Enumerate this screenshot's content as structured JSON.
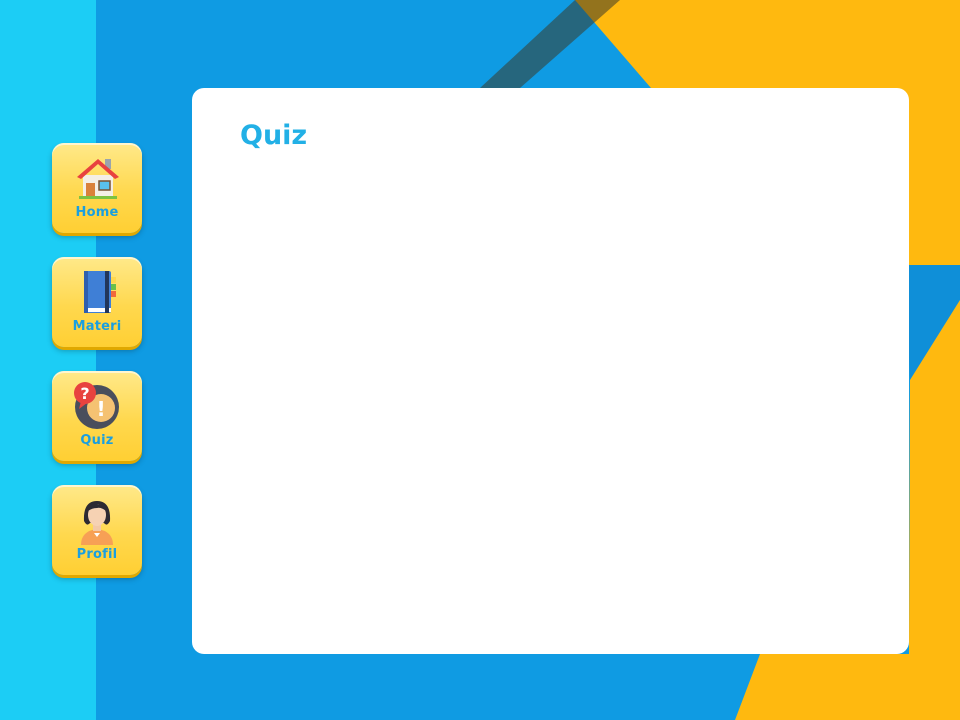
{
  "nav": {
    "items": [
      {
        "label": "Home",
        "icon": "house-icon"
      },
      {
        "label": "Materi",
        "icon": "book-icon"
      },
      {
        "label": "Quiz",
        "icon": "quiz-bubbles-icon"
      },
      {
        "label": "Profil",
        "icon": "user-avatar-icon"
      }
    ]
  },
  "main": {
    "title": "Quiz"
  },
  "colors": {
    "sidebar": "#1ccdf5",
    "background_blue": "#0f9be3",
    "background_yellow": "#ffb90f",
    "button": "#ffd84e",
    "label": "#1a9fe0",
    "title": "#22b0e6"
  }
}
